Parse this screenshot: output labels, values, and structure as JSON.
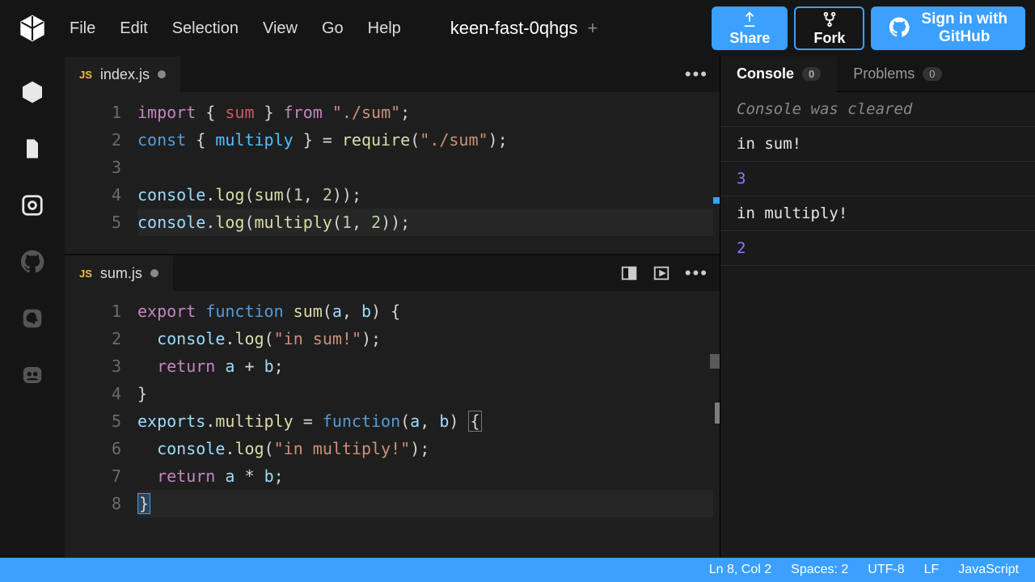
{
  "menu": {
    "items": [
      "File",
      "Edit",
      "Selection",
      "View",
      "Go",
      "Help"
    ]
  },
  "project": {
    "name": "keen-fast-0qhgs"
  },
  "buttons": {
    "share": "Share",
    "fork": "Fork",
    "signin_l1": "Sign in with",
    "signin_l2": "GitHub"
  },
  "editors": [
    {
      "filename": "index.js",
      "badge": "JS",
      "dirty": true,
      "lines": [
        [
          [
            "import ",
            "kw-pink"
          ],
          [
            "{ ",
            ""
          ],
          [
            "sum",
            "kw-red"
          ],
          [
            " } ",
            ""
          ],
          [
            "from ",
            "kw-pink"
          ],
          [
            "\"./sum\"",
            "str"
          ],
          [
            ";",
            ""
          ]
        ],
        [
          [
            "const ",
            "kw-blue"
          ],
          [
            "{ ",
            ""
          ],
          [
            "multiply",
            "var-cyan"
          ],
          [
            " } = ",
            ""
          ],
          [
            "require",
            "fn-yel"
          ],
          [
            "(",
            ""
          ],
          [
            "\"./sum\"",
            "str"
          ],
          [
            ");",
            ""
          ]
        ],
        [
          [
            "",
            ""
          ]
        ],
        [
          [
            "console",
            "prop"
          ],
          [
            ".",
            ""
          ],
          [
            "log",
            "fn-yel"
          ],
          [
            "(",
            ""
          ],
          [
            "sum",
            "fn-yel"
          ],
          [
            "(",
            ""
          ],
          [
            "1",
            "num"
          ],
          [
            ", ",
            ""
          ],
          [
            "2",
            "num"
          ],
          [
            "));",
            ""
          ]
        ],
        [
          [
            "console",
            "prop"
          ],
          [
            ".",
            ""
          ],
          [
            "log",
            "fn-yel"
          ],
          [
            "(",
            ""
          ],
          [
            "multiply",
            "fn-yel"
          ],
          [
            "(",
            ""
          ],
          [
            "1",
            "num"
          ],
          [
            ", ",
            ""
          ],
          [
            "2",
            "num"
          ],
          [
            "));",
            ""
          ]
        ]
      ],
      "highlight_line": 5
    },
    {
      "filename": "sum.js",
      "badge": "JS",
      "dirty": true,
      "show_actions": true,
      "lines": [
        [
          [
            "export ",
            "kw-pink"
          ],
          [
            "function ",
            "kw-blue"
          ],
          [
            "sum",
            "fn-yel"
          ],
          [
            "(",
            ""
          ],
          [
            "a",
            "prop"
          ],
          [
            ", ",
            ""
          ],
          [
            "b",
            "prop"
          ],
          [
            ") {",
            ""
          ]
        ],
        [
          [
            "  ",
            ""
          ],
          [
            "console",
            "prop"
          ],
          [
            ".",
            ""
          ],
          [
            "log",
            "fn-yel"
          ],
          [
            "(",
            ""
          ],
          [
            "\"in sum!\"",
            "str"
          ],
          [
            ");",
            ""
          ]
        ],
        [
          [
            "  ",
            ""
          ],
          [
            "return ",
            "kw-pink"
          ],
          [
            "a",
            "prop"
          ],
          [
            " + ",
            ""
          ],
          [
            "b",
            "prop"
          ],
          [
            ";",
            ""
          ]
        ],
        [
          [
            "}",
            ""
          ]
        ],
        [
          [
            "exports",
            "prop"
          ],
          [
            ".",
            ""
          ],
          [
            "multiply",
            "fn-yel"
          ],
          [
            " = ",
            ""
          ],
          [
            "function",
            "kw-blue"
          ],
          [
            "(",
            ""
          ],
          [
            "a",
            "prop"
          ],
          [
            ", ",
            ""
          ],
          [
            "b",
            "prop"
          ],
          [
            ") ",
            ""
          ],
          [
            "{",
            "bracket-hl"
          ]
        ],
        [
          [
            "  ",
            ""
          ],
          [
            "console",
            "prop"
          ],
          [
            ".",
            ""
          ],
          [
            "log",
            "fn-yel"
          ],
          [
            "(",
            ""
          ],
          [
            "\"in multiply!\"",
            "str"
          ],
          [
            ");",
            ""
          ]
        ],
        [
          [
            "  ",
            ""
          ],
          [
            "return ",
            "kw-pink"
          ],
          [
            "a",
            "prop"
          ],
          [
            " * ",
            ""
          ],
          [
            "b",
            "prop"
          ],
          [
            ";",
            ""
          ]
        ],
        [
          [
            "}",
            "cursor-mark"
          ]
        ]
      ],
      "highlight_line": 8
    }
  ],
  "panel": {
    "tabs": [
      {
        "label": "Console",
        "count": "0",
        "active": true
      },
      {
        "label": "Problems",
        "count": "0",
        "active": false
      }
    ],
    "console": [
      {
        "text": "Console was cleared",
        "cls": "ital"
      },
      {
        "text": "in sum!",
        "cls": ""
      },
      {
        "text": "3",
        "cls": "numcol"
      },
      {
        "text": "in multiply!",
        "cls": ""
      },
      {
        "text": "2",
        "cls": "numcol"
      }
    ]
  },
  "status": {
    "pos": "Ln 8, Col 2",
    "spaces": "Spaces: 2",
    "enc": "UTF-8",
    "eol": "LF",
    "lang": "JavaScript"
  }
}
